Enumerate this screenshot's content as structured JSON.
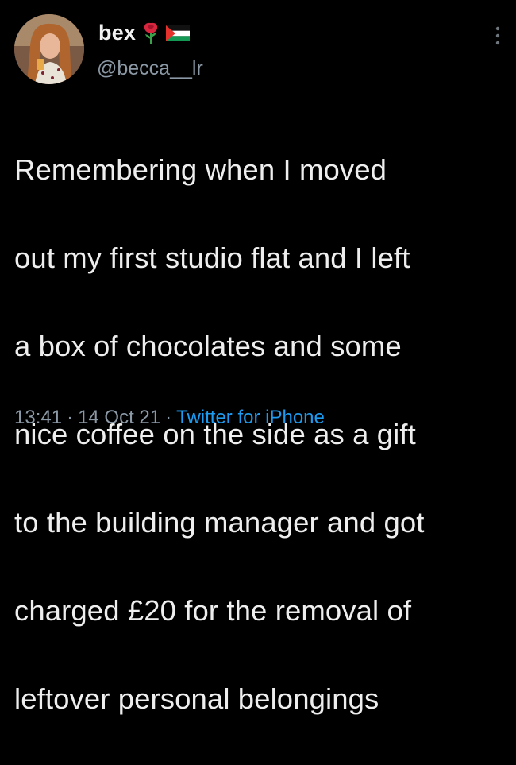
{
  "tweet": {
    "author": {
      "display_name": "bex",
      "handle": "@becca__lr",
      "name_icons": [
        "rose-icon",
        "palestine-flag-icon"
      ]
    },
    "text_lines": [
      "Remembering when I moved",
      "out my first studio flat and I left",
      "a box of chocolates and some",
      "nice coffee on the side as a gift",
      "to the building manager and got",
      "charged £20 for the removal of",
      "leftover personal belongings"
    ],
    "meta": {
      "time": "13:41",
      "separator": "·",
      "date": "14 Oct 21",
      "source": "Twitter for iPhone"
    }
  },
  "colors": {
    "background": "#000000",
    "text": "#eeeeee",
    "secondary": "#8b98a5",
    "accent": "#1d9bf0"
  }
}
